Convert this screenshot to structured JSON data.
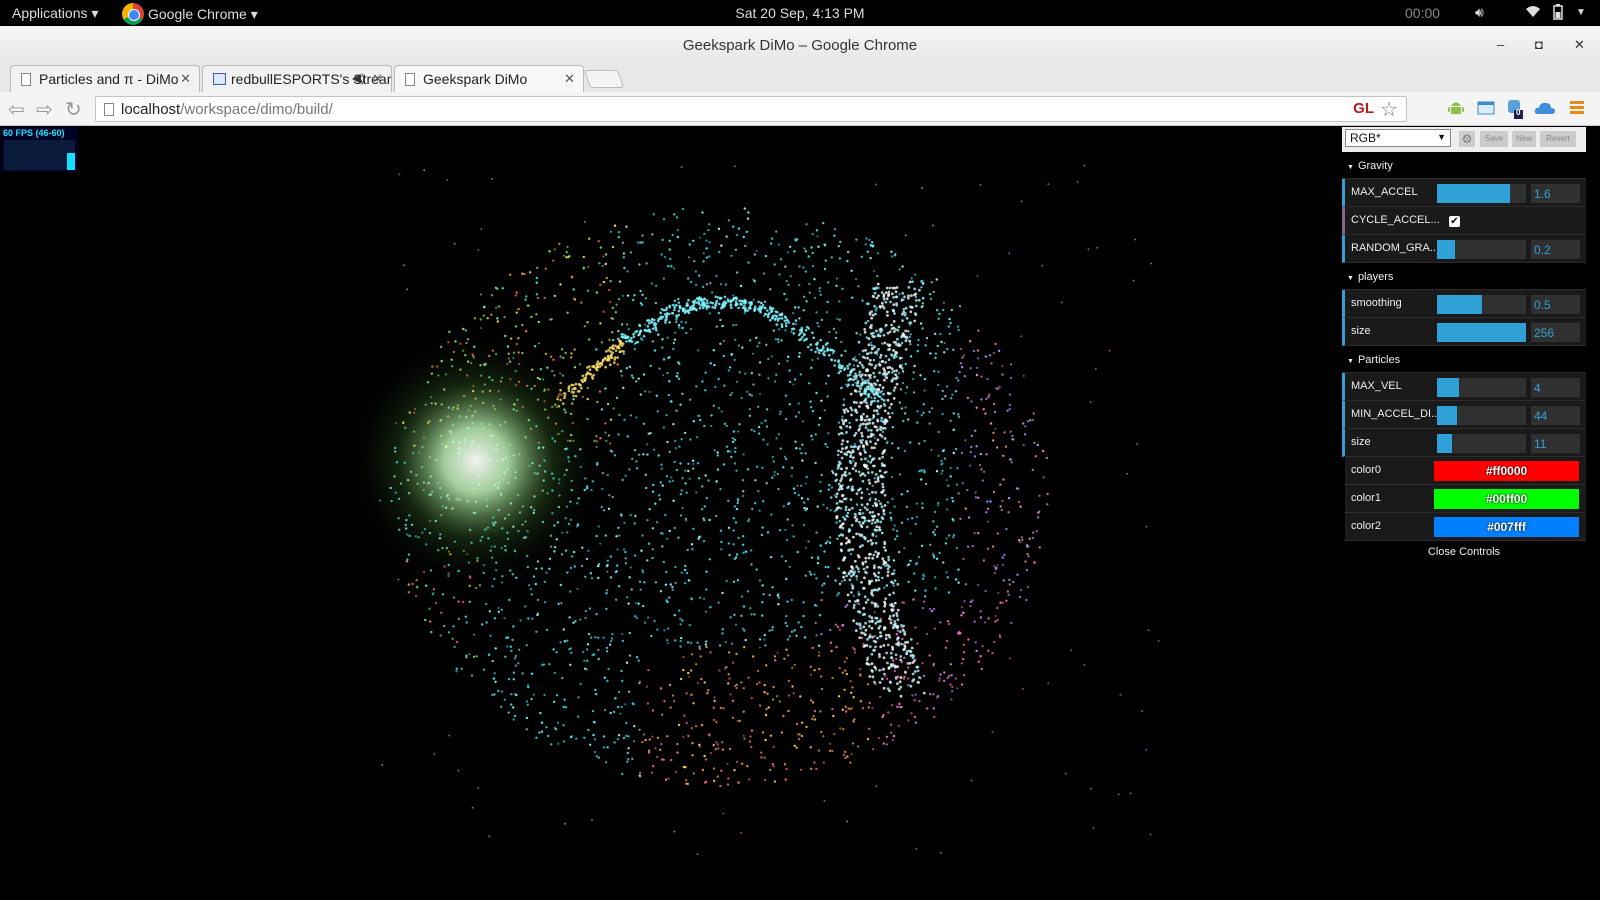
{
  "topbar": {
    "applications": "Applications ▾",
    "app_menu": "Google Chrome ▾",
    "clock": "Sat 20 Sep,  4:13 PM",
    "timer": "00:00"
  },
  "window": {
    "title": "Geekspark DiMo – Google Chrome"
  },
  "tabs": [
    {
      "label": "Particles and π - DiMo"
    },
    {
      "label": "redbullESPORTS's Stream"
    },
    {
      "label": "Geekspark DiMo"
    }
  ],
  "omnibox": {
    "host": "localhost",
    "path": "/workspace/dimo/build/",
    "gl_badge": "GL",
    "ext_badge_count": "0"
  },
  "fps": {
    "label": "60 FPS (46-60)",
    "level": 0.57
  },
  "gui": {
    "preset": "RGB*",
    "save": "Save",
    "new": "New",
    "revert": "Revert",
    "folders": {
      "gravity": "Gravity",
      "players": "players",
      "particles": "Particles"
    },
    "gravity": {
      "max_accel": {
        "label": "MAX_ACCEL",
        "value": "1.6",
        "fill": 0.82
      },
      "cycle_accel": {
        "label": "CYCLE_ACCEL...",
        "checked": true
      },
      "random_grav": {
        "label": "RANDOM_GRA...",
        "value": "0.2",
        "fill": 0.2
      }
    },
    "players": {
      "smoothing": {
        "label": "smoothing",
        "value": "0.5",
        "fill": 0.5
      },
      "size": {
        "label": "size",
        "value": "256",
        "fill": 1.0
      }
    },
    "particles": {
      "max_vel": {
        "label": "MAX_VEL",
        "value": "4",
        "fill": 0.25
      },
      "min_accel_dist": {
        "label": "MIN_ACCEL_DI...",
        "value": "44",
        "fill": 0.22
      },
      "size": {
        "label": "size",
        "value": "11",
        "fill": 0.17
      },
      "color0": {
        "label": "color0",
        "value": "#ff0000"
      },
      "color1": {
        "label": "color1",
        "value": "#00ff00"
      },
      "color2": {
        "label": "color2",
        "value": "#007fff"
      }
    },
    "close_controls": "Close Controls"
  },
  "colors": {
    "gui_accent": "#2fa1d6",
    "fps_bar": "#11e0ff"
  }
}
